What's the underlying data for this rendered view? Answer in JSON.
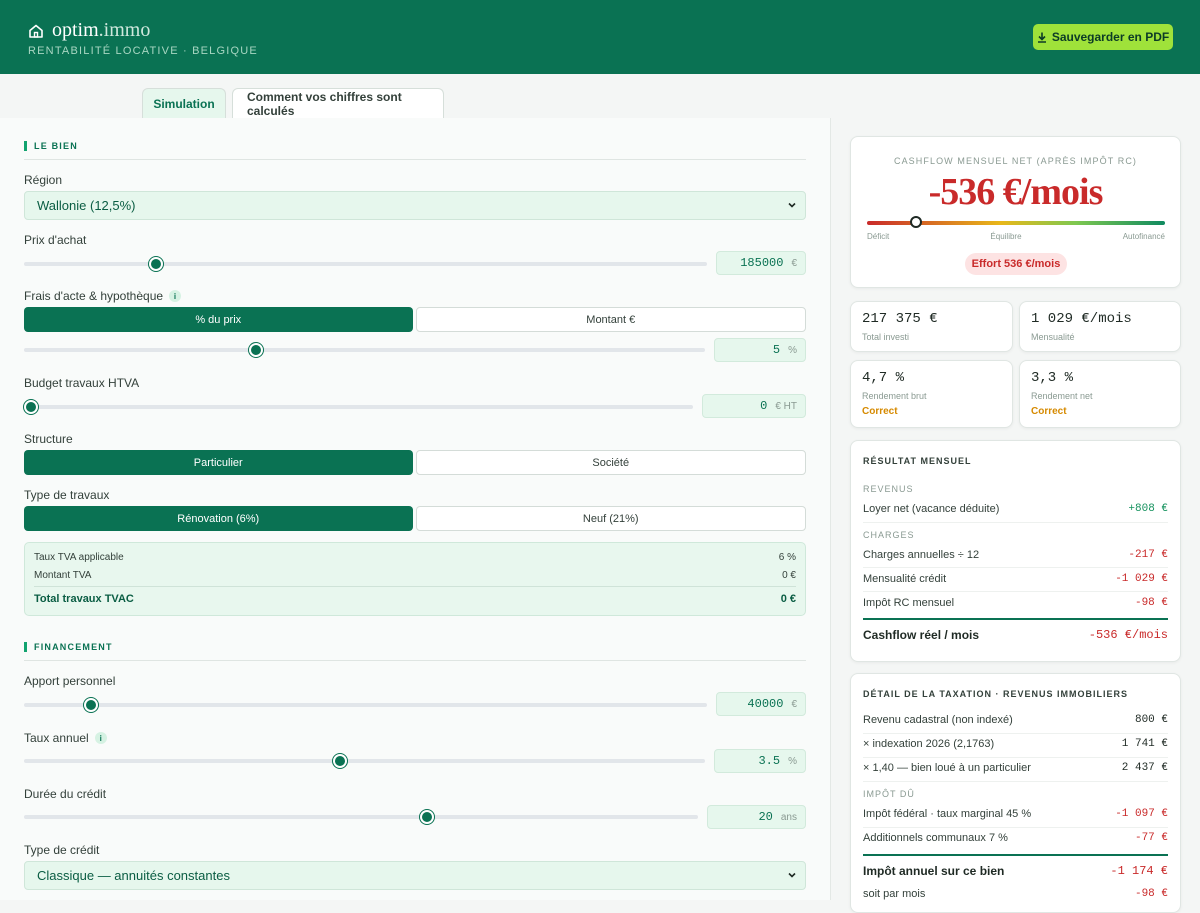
{
  "header": {
    "brand_main": "optim",
    "brand_dim": ".immo",
    "subtitle": "RENTABILITÉ LOCATIVE · BELGIQUE",
    "pdf_button": "Sauvegarder en PDF",
    "pdf_icon": "download-icon",
    "brand_icon": "house-icon"
  },
  "tabs": [
    {
      "label": "Simulation",
      "active": true
    },
    {
      "label": "Comment vos chiffres sont calculés",
      "active": false
    }
  ],
  "bien": {
    "section": "LE BIEN",
    "region_label": "Région",
    "region_value": "Wallonie (12,5%)",
    "prix_label": "Prix d'achat",
    "prix_value": "185000",
    "prix_unit": "€",
    "frais_label": "Frais d'acte & hypothèque",
    "frais_info": "i",
    "frais_modes": [
      "% du prix",
      "Montant €"
    ],
    "frais_value": "5",
    "frais_unit": "%",
    "travaux_label": "Budget travaux HTVA",
    "travaux_value": "0",
    "travaux_unit": "€ HT",
    "structure_label": "Structure",
    "structure_options": [
      "Particulier",
      "Société"
    ],
    "type_travaux_label": "Type de travaux",
    "type_travaux_options": [
      "Rénovation (6%)",
      "Neuf (21%)"
    ],
    "tva": {
      "taux_label": "Taux TVA applicable",
      "taux_value": "6 %",
      "montant_label": "Montant TVA",
      "montant_value": "0 €",
      "total_label": "Total travaux TVAC",
      "total_value": "0 €"
    }
  },
  "financement": {
    "section": "FINANCEMENT",
    "apport_label": "Apport personnel",
    "apport_value": "40000",
    "apport_unit": "€",
    "taux_label": "Taux annuel",
    "taux_info": "i",
    "taux_value": "3.5",
    "taux_unit": "%",
    "duree_label": "Durée du crédit",
    "duree_value": "20",
    "duree_unit": "ans",
    "type_credit_label": "Type de crédit",
    "type_credit_value": "Classique — annuités constantes"
  },
  "sliders": {
    "prix_fraction": 0.187,
    "frais_fraction": 0.337,
    "travaux_fraction": 0.0,
    "apport_fraction": 0.089,
    "taux_fraction": 0.463,
    "duree_fraction": 0.6
  },
  "cashflow": {
    "label": "CASHFLOW MENSUEL NET (APRÈS IMPÔT RC)",
    "value": "-536 €/mois",
    "gauge_fraction": 0.165,
    "gauge_labels": [
      "Déficit",
      "Équilibre",
      "Autofinancé"
    ],
    "effort": "Effort 536 €/mois"
  },
  "kpis": [
    {
      "value": "217 375 €",
      "label": "Total investi",
      "tag": ""
    },
    {
      "value": "1 029 €/mois",
      "label": "Mensualité",
      "tag": ""
    },
    {
      "value": "4,7 %",
      "label": "Rendement brut",
      "tag": "Correct"
    },
    {
      "value": "3,3 %",
      "label": "Rendement net",
      "tag": "Correct"
    }
  ],
  "resultat": {
    "title": "RÉSULTAT MENSUEL",
    "revenus_label": "REVENUS",
    "loyer_label": "Loyer net (vacance déduite)",
    "loyer_value": "+808 €",
    "charges_group": "CHARGES",
    "charges_label": "Charges annuelles ÷ 12",
    "charges_value": "-217 €",
    "mensualite_label": "Mensualité crédit",
    "mensualite_value": "-1 029 €",
    "impot_label": "Impôt RC mensuel",
    "impot_value": "-98 €",
    "total_label": "Cashflow réel / mois",
    "total_value": "-536 €/mois"
  },
  "taxation": {
    "title": "DÉTAIL DE LA TAXATION · REVENUS IMMOBILIERS",
    "rc_label": "Revenu cadastral (non indexé)",
    "rc_value": "800 €",
    "index_label": "× indexation 2026 (2,1763)",
    "index_value": "1 741 €",
    "coef_label": "× 1,40 — bien loué à un particulier",
    "coef_value": "2 437 €",
    "impot_group": "IMPÔT DÛ",
    "federal_label": "Impôt fédéral · taux marginal 45 %",
    "federal_value": "-1 097 €",
    "communal_label": "Additionnels communaux 7 %",
    "communal_value": "-77 €",
    "total_label": "Impôt annuel sur ce bien",
    "total_value": "-1 174 €",
    "mois_label": "soit par mois",
    "mois_value": "-98 €"
  },
  "colors": {
    "brand": "#0a7253",
    "accent": "#9fe23a",
    "negative": "#c92a2a",
    "positive": "#15925e",
    "warning": "#d68a00"
  }
}
